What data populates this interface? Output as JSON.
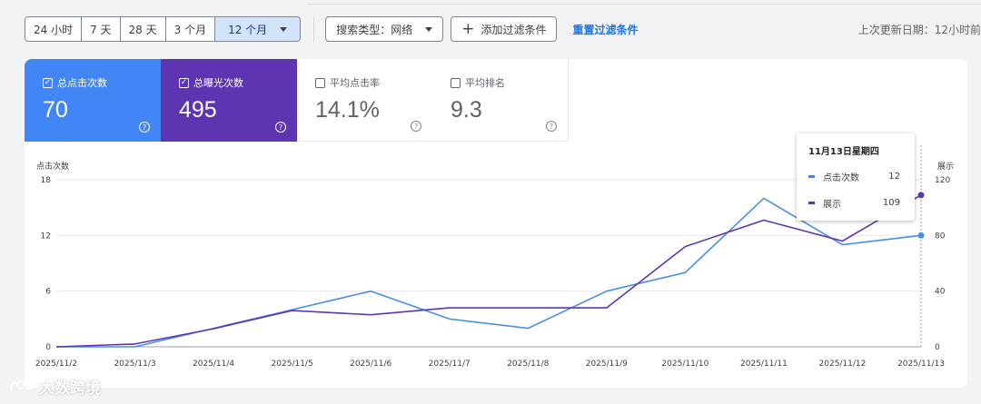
{
  "toolbar": {
    "ranges": [
      "24 小时",
      "7 天",
      "28 天",
      "3 个月",
      "12 个月"
    ],
    "active_range": "12 个月",
    "search_type": "搜索类型：网络",
    "add_filter": "添加过滤条件",
    "reset_filter": "重置过滤条件",
    "last_updated": "上次更新日期：12小时前"
  },
  "metrics": [
    {
      "label": "总点击次数",
      "value": "70",
      "checked": true,
      "color": "#4285f4"
    },
    {
      "label": "总曝光次数",
      "value": "495",
      "checked": true,
      "color": "#5e35b1"
    },
    {
      "label": "平均点击率",
      "value": "14.1%",
      "checked": false
    },
    {
      "label": "平均排名",
      "value": "9.3",
      "checked": false
    }
  ],
  "tooltip": {
    "date": "11月13日星期四",
    "rows": [
      {
        "name": "点击次数",
        "value": "12",
        "color": "#4285f4"
      },
      {
        "name": "展示",
        "value": "109",
        "color": "#5e35b1"
      }
    ]
  },
  "watermark": "大数跨境",
  "chart_data": {
    "type": "line",
    "categories": [
      "2025/11/2",
      "2025/11/3",
      "2025/11/4",
      "2025/11/5",
      "2025/11/6",
      "2025/11/7",
      "2025/11/8",
      "2025/11/9",
      "2025/11/10",
      "2025/11/11",
      "2025/11/12",
      "2025/11/13"
    ],
    "ylabel_left": "点击次数",
    "ylabel_right": "展示",
    "yticks_left": [
      "0",
      "6",
      "12",
      "18"
    ],
    "yticks_right": [
      "0",
      "40",
      "80",
      "120"
    ],
    "ylim_left": [
      0,
      18
    ],
    "ylim_right": [
      0,
      120
    ],
    "grid": true,
    "series": [
      {
        "name": "点击次数",
        "axis": "left",
        "color": "#4a90e2",
        "values": [
          0,
          0,
          2,
          4,
          6,
          3,
          2,
          6,
          8,
          16,
          11,
          12
        ]
      },
      {
        "name": "展示",
        "axis": "right",
        "color": "#5e35b1",
        "values": [
          0,
          2,
          13,
          26,
          23,
          28,
          28,
          28,
          72,
          91,
          76,
          109
        ]
      }
    ]
  }
}
